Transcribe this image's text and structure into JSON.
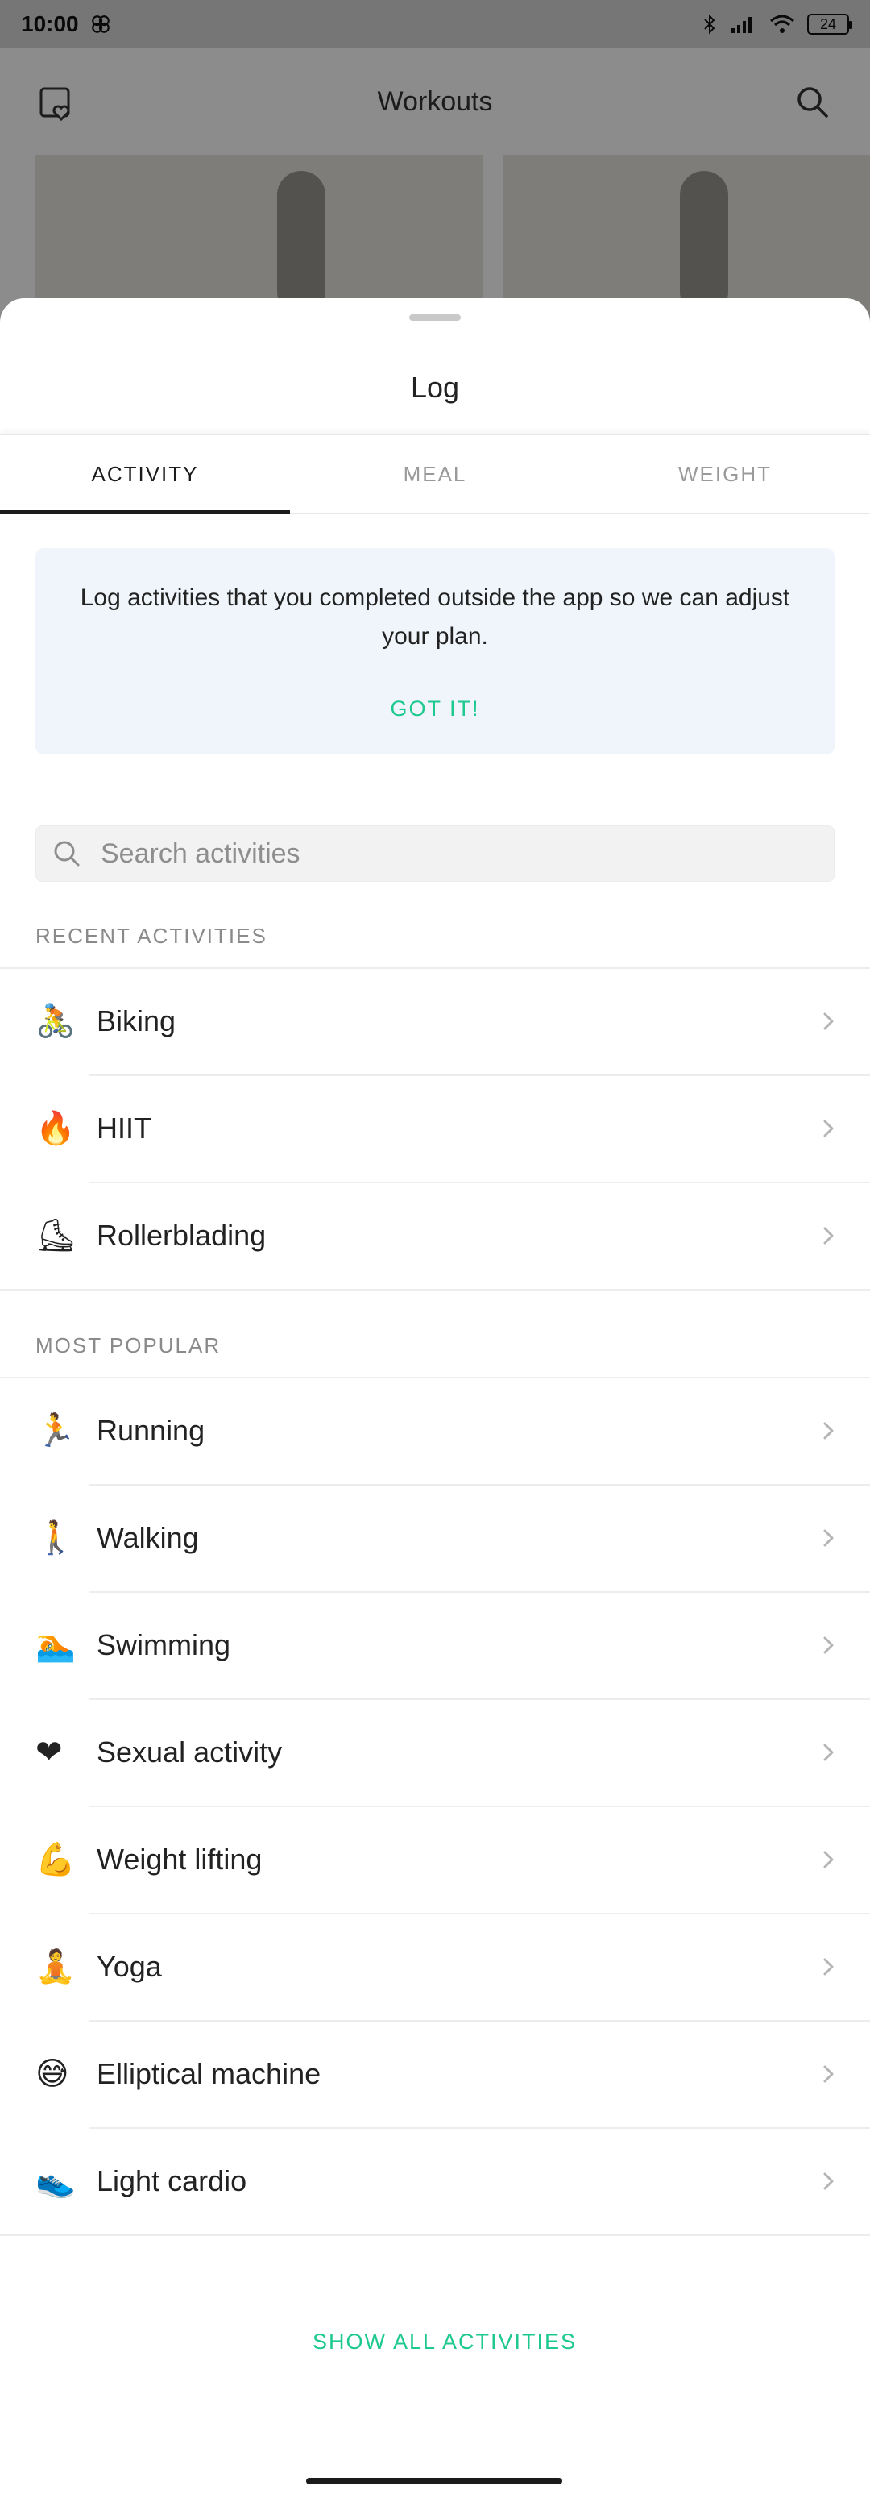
{
  "status_bar": {
    "time": "10:00",
    "battery": "24"
  },
  "app": {
    "title": "Workouts"
  },
  "sheet": {
    "title": "Log",
    "tabs": [
      {
        "label": "ACTIVITY",
        "active": true
      },
      {
        "label": "MEAL",
        "active": false
      },
      {
        "label": "WEIGHT",
        "active": false
      }
    ],
    "info": {
      "text": "Log activities that you completed outside the app so we can adjust your plan.",
      "dismiss_label": "GOT IT!"
    },
    "search": {
      "placeholder": "Search activities",
      "value": ""
    },
    "recent": {
      "label": "RECENT ACTIVITIES",
      "items": [
        {
          "emoji": "🚴",
          "label": "Biking"
        },
        {
          "emoji": "🔥",
          "label": "HIIT"
        },
        {
          "emoji": "⛸",
          "label": "Rollerblading"
        }
      ]
    },
    "popular": {
      "label": "MOST POPULAR",
      "items": [
        {
          "emoji": "🏃",
          "label": "Running"
        },
        {
          "emoji": "🚶",
          "label": "Walking"
        },
        {
          "emoji": "🏊",
          "label": "Swimming"
        },
        {
          "emoji": "❤",
          "label": "Sexual activity"
        },
        {
          "emoji": "💪",
          "label": "Weight lifting"
        },
        {
          "emoji": "🧘",
          "label": "Yoga"
        },
        {
          "emoji": "😅",
          "label": "Elliptical machine"
        },
        {
          "emoji": "👟",
          "label": "Light cardio"
        }
      ]
    },
    "show_all_label": "SHOW ALL ACTIVITIES"
  },
  "colors": {
    "accent": "#1dc98f",
    "info_bg": "#eff5fb",
    "text": "#222222",
    "muted": "#8a8a8a"
  }
}
